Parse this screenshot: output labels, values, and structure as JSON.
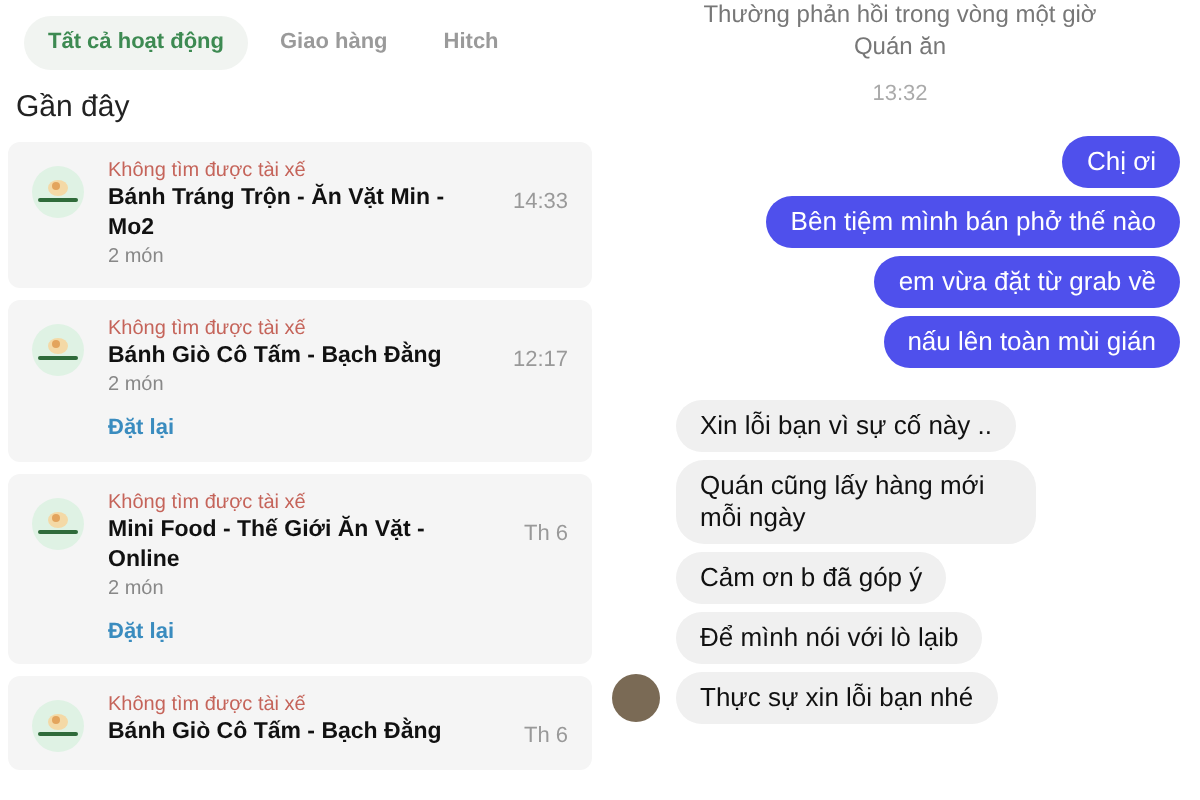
{
  "tabs": [
    {
      "label": "Tất cả hoạt động",
      "selected": true
    },
    {
      "label": "Giao hàng",
      "selected": false
    },
    {
      "label": "Hitch",
      "selected": false
    }
  ],
  "section_title": "Gần đây",
  "orders": [
    {
      "status": "Không tìm được tài xế",
      "name": "Bánh Tráng Trộn - Ăn Vặt Min - Mo2",
      "items": "2 món",
      "time": "14:33"
    },
    {
      "status": "Không tìm được tài xế",
      "name": "Bánh Giò Cô Tấm - Bạch Đằng",
      "items": "2 món",
      "time": "12:17",
      "reorder": "Đặt lại"
    },
    {
      "status": "Không tìm được tài xế",
      "name": "Mini Food - Thế Giới Ăn Vặt - Online",
      "items": "2 món",
      "time": "Th 6",
      "reorder": "Đặt lại"
    },
    {
      "status": "Không tìm được tài xế",
      "name": "Bánh Giò Cô Tấm - Bạch Đằng",
      "time": "Th 6"
    }
  ],
  "chat": {
    "response_note": "Thường phản hồi trong vòng một giờ",
    "contact": "Quán ăn",
    "timestamp": "13:32",
    "messages": [
      {
        "kind": "outgoing",
        "text": "Chị ơi"
      },
      {
        "kind": "outgoing",
        "text": "Bên tiệm mình bán phở thế nào"
      },
      {
        "kind": "outgoing",
        "text": "em vừa đặt từ grab về"
      },
      {
        "kind": "outgoing",
        "text": "nấu lên toàn mùi gián"
      },
      {
        "kind": "incoming",
        "text": "Xin lỗi bạn vì sự cố này ..",
        "avatar": false
      },
      {
        "kind": "incoming",
        "text": "Quán cũng lấy hàng mới mỗi ngày",
        "avatar": false
      },
      {
        "kind": "incoming",
        "text": "Cảm ơn b đã góp ý",
        "avatar": false
      },
      {
        "kind": "incoming",
        "text": "Để mình nói với lò lạib",
        "avatar": false
      },
      {
        "kind": "incoming",
        "text": "Thực sự xin lỗi bạn nhé",
        "avatar": true
      }
    ]
  }
}
